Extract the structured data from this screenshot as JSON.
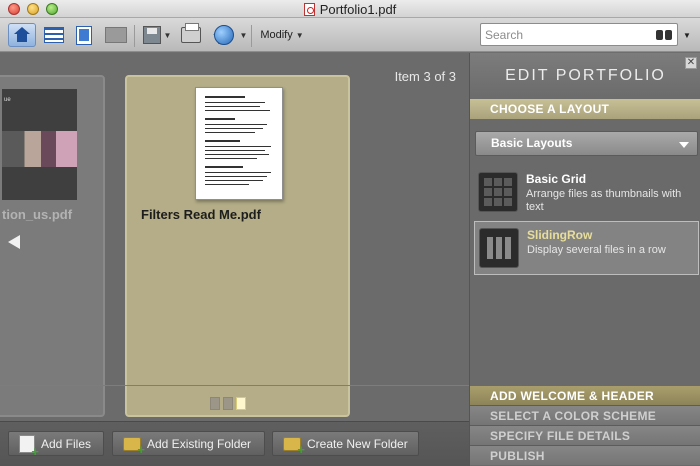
{
  "window": {
    "title": "Portfolio1.pdf"
  },
  "toolbar": {
    "modify_label": "Modify",
    "search_placeholder": "Search"
  },
  "content": {
    "item_count": "Item 3 of 3",
    "left_card": {
      "filename": "tion_us.pdf",
      "logo_text": "ue"
    },
    "main_card": {
      "filename": "Filters Read Me.pdf"
    },
    "pager": {
      "pages": 3,
      "active_page": 3
    }
  },
  "bottom_bar": {
    "add_files": "Add Files",
    "add_existing_folder": "Add Existing Folder",
    "create_new_folder": "Create New Folder"
  },
  "sidebar": {
    "title": "EDIT PORTFOLIO",
    "choose_layout": "CHOOSE A LAYOUT",
    "layout_select": "Basic Layouts",
    "layouts": [
      {
        "name": "Basic Grid",
        "description": "Arrange files as thumbnails with text",
        "selected": false
      },
      {
        "name": "SlidingRow",
        "description": "Display several files in a row",
        "selected": true
      }
    ],
    "sections": [
      "ADD WELCOME & HEADER",
      "SELECT A COLOR SCHEME",
      "SPECIFY FILE DETAILS",
      "PUBLISH"
    ]
  },
  "colors": {
    "card_active": "#b4ad87",
    "section_active": "#c7bf96",
    "accent_text": "#e8de9a"
  }
}
